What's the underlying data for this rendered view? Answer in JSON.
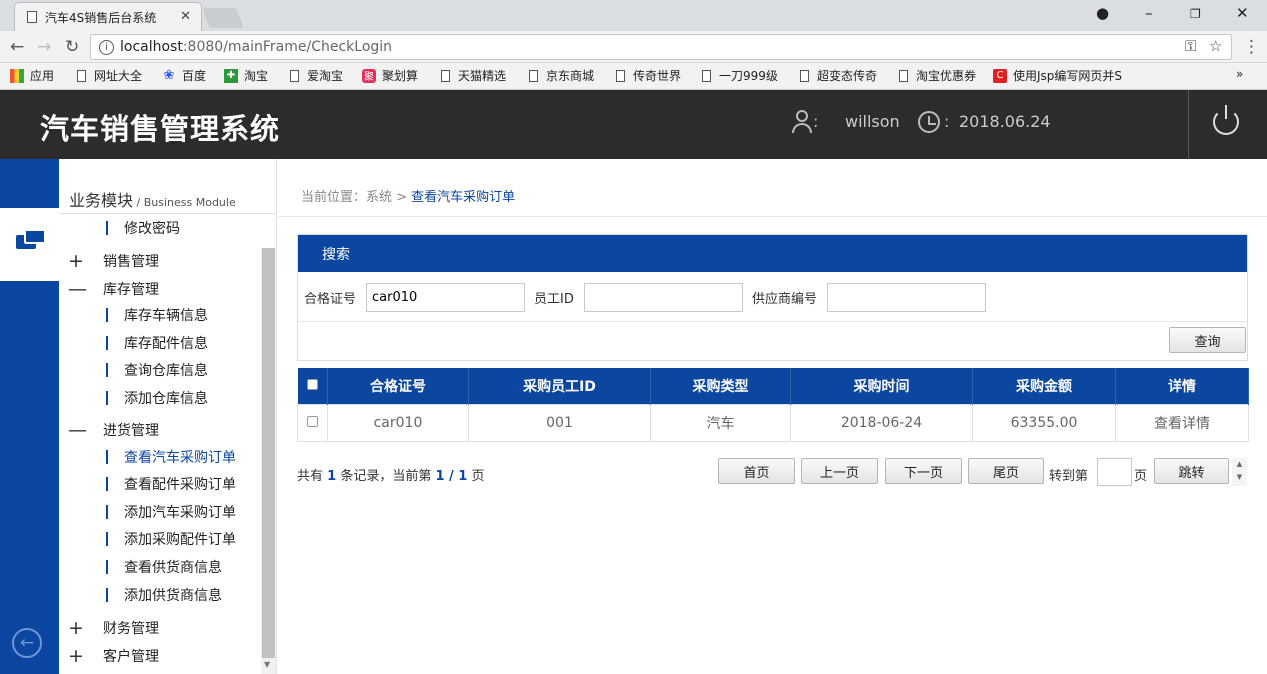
{
  "browser": {
    "tab_title": "汽车4S销售后台系统",
    "url_host": "localhost",
    "url_path": ":8080/mainFrame/CheckLogin",
    "bookmarks": [
      "应用",
      "网址大全",
      "百度",
      "淘宝",
      "爱淘宝",
      "聚划算",
      "天猫精选",
      "京东商城",
      "传奇世界",
      "一刀999级",
      "超变态传奇",
      "淘宝优惠券",
      "使用Jsp编写网页并S"
    ],
    "bookmarks_more": "»"
  },
  "header": {
    "title": "汽车销售管理系统",
    "colon": ":",
    "username": "willson",
    "date": "2018.06.24"
  },
  "sidebar": {
    "module_title": "业务模块",
    "module_sep": " / ",
    "module_subtitle": "Business Module",
    "items": [
      {
        "label": "修改密码",
        "type": "sub"
      },
      {
        "label": "销售管理",
        "type": "group",
        "symbol": "+"
      },
      {
        "label": "库存管理",
        "type": "group",
        "symbol": "—"
      },
      {
        "label": "库存车辆信息",
        "type": "sub"
      },
      {
        "label": "库存配件信息",
        "type": "sub"
      },
      {
        "label": "查询仓库信息",
        "type": "sub"
      },
      {
        "label": "添加仓库信息",
        "type": "sub"
      },
      {
        "label": "进货管理",
        "type": "group",
        "symbol": "—"
      },
      {
        "label": "查看汽车采购订单",
        "type": "sub",
        "active": true
      },
      {
        "label": "查看配件采购订单",
        "type": "sub"
      },
      {
        "label": "添加汽车采购订单",
        "type": "sub"
      },
      {
        "label": "添加采购配件订单",
        "type": "sub"
      },
      {
        "label": "查看供货商信息",
        "type": "sub"
      },
      {
        "label": "添加供货商信息",
        "type": "sub"
      },
      {
        "label": "财务管理",
        "type": "group",
        "symbol": "+"
      },
      {
        "label": "客户管理",
        "type": "group",
        "symbol": "+"
      }
    ]
  },
  "breadcrumb": {
    "prefix": "当前位置：系统 > ",
    "current": "查看汽车采购订单"
  },
  "search": {
    "title": "搜索",
    "fields": [
      {
        "label": "合格证号",
        "value": "car010"
      },
      {
        "label": "员工ID",
        "value": ""
      },
      {
        "label": "供应商编号",
        "value": ""
      }
    ],
    "query_button": "查询"
  },
  "table": {
    "columns": [
      "合格证号",
      "采购员工ID",
      "采购类型",
      "采购时间",
      "采购金额",
      "详情"
    ],
    "rows": [
      [
        "car010",
        "001",
        "汽车",
        "2018-06-24",
        "63355.00",
        "查看详情"
      ]
    ]
  },
  "pager": {
    "text_1": "共有 ",
    "total": "1",
    "text_2": " 条记录，当前第 ",
    "current": "1 / 1",
    "text_3": " 页",
    "first": "首页",
    "prev": "上一页",
    "next": "下一页",
    "last": "尾页",
    "goto_label": "转到第",
    "page_unit": "页",
    "jump": "跳转"
  }
}
